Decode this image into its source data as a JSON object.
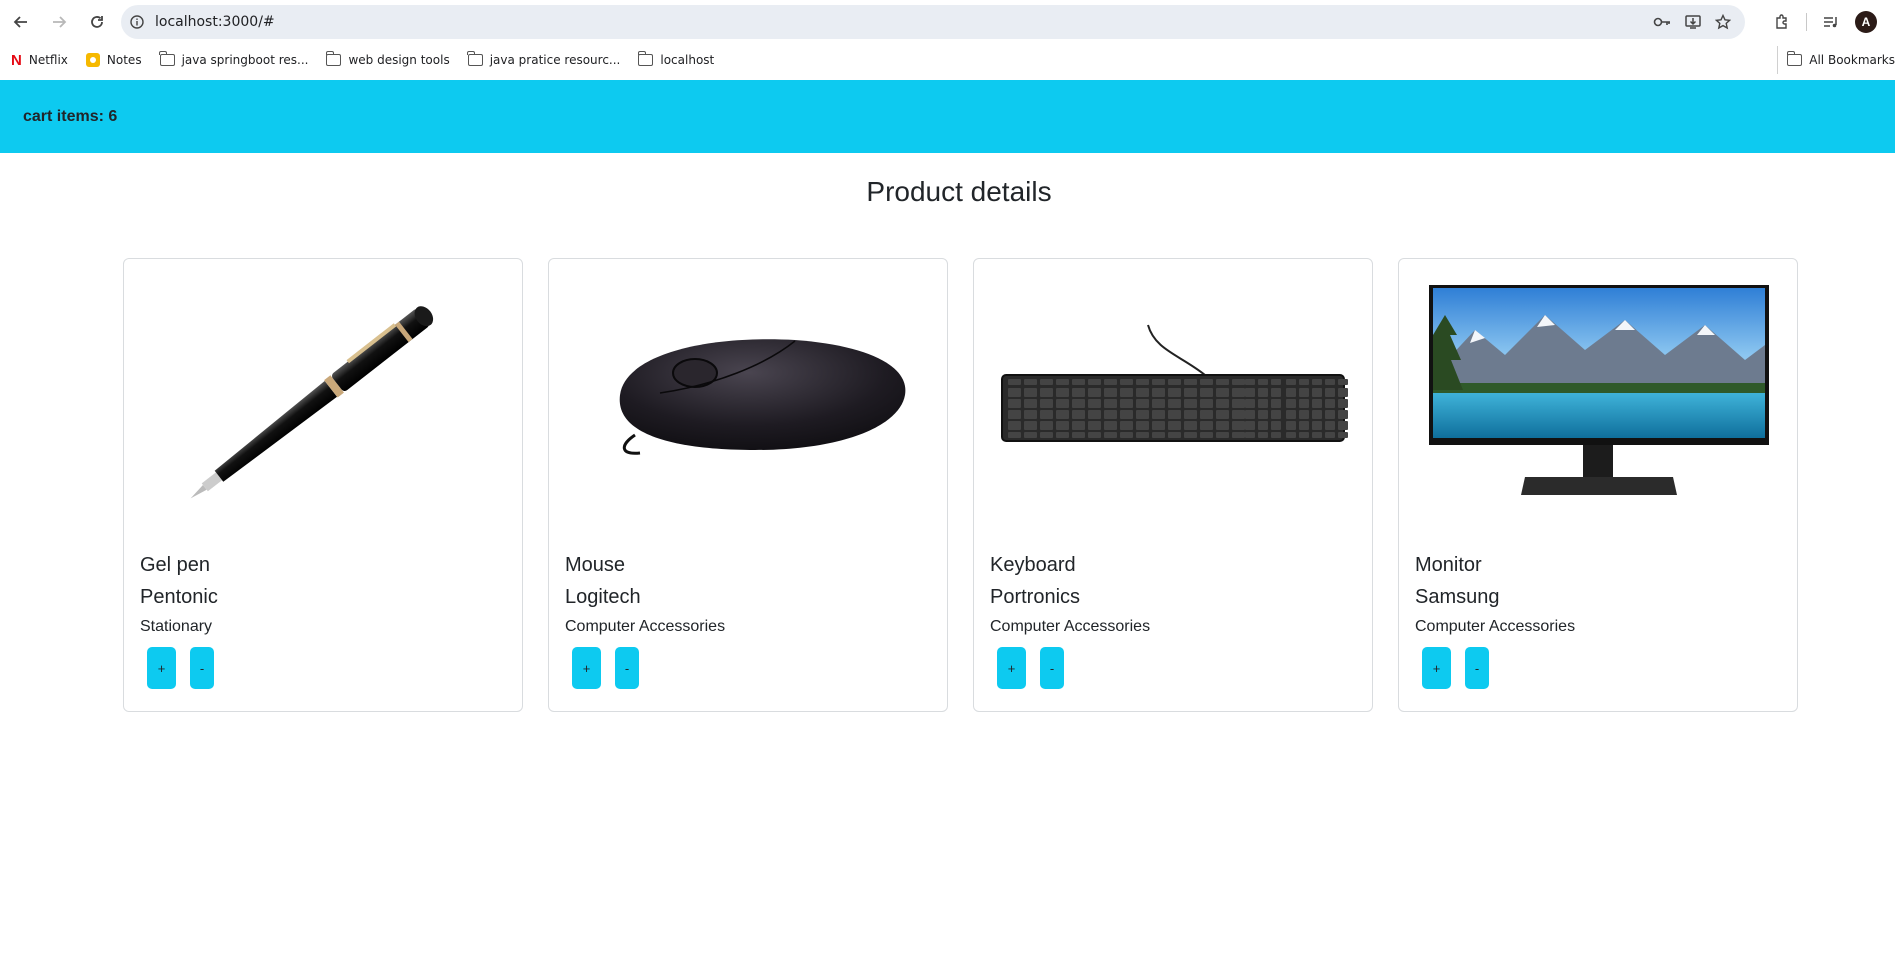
{
  "browser": {
    "url": "localhost:3000/#",
    "bookmarks": [
      {
        "label": "Netflix",
        "icon": "netflix-icon"
      },
      {
        "label": "Notes",
        "icon": "notes-icon"
      },
      {
        "label": "java springboot res...",
        "icon": "folder-icon"
      },
      {
        "label": "web design tools",
        "icon": "folder-icon"
      },
      {
        "label": "java pratice resourc...",
        "icon": "folder-icon"
      },
      {
        "label": "localhost",
        "icon": "folder-icon"
      }
    ],
    "all_bookmarks_label": "All Bookmarks",
    "avatar_letter": "A"
  },
  "navbar": {
    "cart_label": "cart items: 6",
    "color": "#0dcaf0"
  },
  "main": {
    "title": "Product details",
    "products": [
      {
        "name": "Gel pen",
        "brand": "Pentonic",
        "category": "Stationary",
        "image": "pen-image",
        "plus": "+",
        "minus": "-"
      },
      {
        "name": "Mouse",
        "brand": "Logitech",
        "category": "Computer Accessories",
        "image": "mouse-image",
        "plus": "+",
        "minus": "-"
      },
      {
        "name": "Keyboard",
        "brand": "Portronics",
        "category": "Computer Accessories",
        "image": "keyboard-image",
        "plus": "+",
        "minus": "-"
      },
      {
        "name": "Monitor",
        "brand": "Samsung",
        "category": "Computer Accessories",
        "image": "monitor-image",
        "plus": "+",
        "minus": "-"
      }
    ]
  }
}
